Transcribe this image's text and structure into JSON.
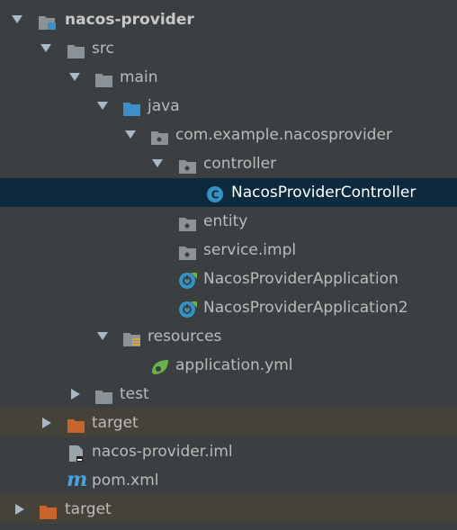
{
  "tree": {
    "nacos_provider": {
      "label": "nacos-provider"
    },
    "src": {
      "label": "src"
    },
    "main": {
      "label": "main"
    },
    "java": {
      "label": "java"
    },
    "package": {
      "label": "com.example.nacosprovider"
    },
    "controller": {
      "label": "controller"
    },
    "controller_class": {
      "label": "NacosProviderController"
    },
    "entity": {
      "label": "entity"
    },
    "service_impl": {
      "label": "service.impl"
    },
    "app1": {
      "label": "NacosProviderApplication"
    },
    "app2": {
      "label": "NacosProviderApplication2"
    },
    "resources": {
      "label": "resources"
    },
    "application_yml": {
      "label": "application.yml"
    },
    "test": {
      "label": "test"
    },
    "inner_target": {
      "label": "target"
    },
    "iml": {
      "label": "nacos-provider.iml"
    },
    "pom": {
      "label": "pom.xml"
    },
    "outer_target": {
      "label": "target"
    }
  },
  "colors": {
    "background": "#3c3f41",
    "selection": "#0d293e",
    "excluded_row": "#45423a",
    "folder_gray": "#8b9399",
    "folder_blue": "#3d8fc9",
    "folder_orange": "#c8642d",
    "class_blue": "#3592c4",
    "spring_green": "#6ab04c",
    "maven_blue": "#4aa3df"
  }
}
